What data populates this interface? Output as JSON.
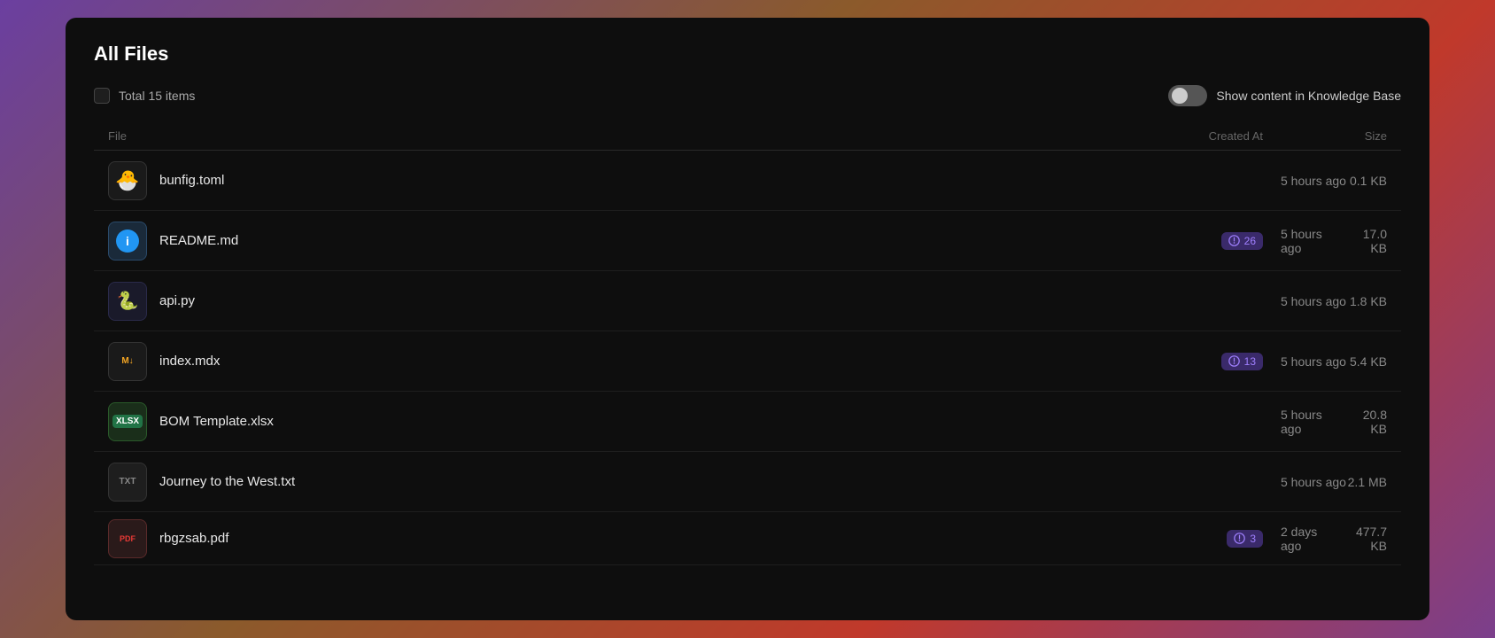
{
  "page": {
    "title": "All Files",
    "total_items_label": "Total 15 items",
    "toggle_label": "Show content in Knowledge Base"
  },
  "table": {
    "headers": {
      "file": "File",
      "created_at": "Created At",
      "size": "Size"
    },
    "rows": [
      {
        "id": "row-1",
        "name": "bunfig.toml",
        "icon_type": "bun",
        "icon_label": "🐣",
        "created_at": "5 hours ago",
        "size": "0.1 KB",
        "chunk_count": null
      },
      {
        "id": "row-2",
        "name": "README.md",
        "icon_type": "readme",
        "icon_label": "ℹ",
        "created_at": "5 hours ago",
        "size": "17.0 KB",
        "chunk_count": 26
      },
      {
        "id": "row-3",
        "name": "api.py",
        "icon_type": "py",
        "icon_label": "🐍",
        "created_at": "5 hours ago",
        "size": "1.8 KB",
        "chunk_count": null
      },
      {
        "id": "row-4",
        "name": "index.mdx",
        "icon_type": "mdx",
        "icon_label": "M↓",
        "created_at": "5 hours ago",
        "size": "5.4 KB",
        "chunk_count": 13
      },
      {
        "id": "row-5",
        "name": "BOM Template.xlsx",
        "icon_type": "xlsx",
        "icon_label": "XLSX",
        "created_at": "5 hours ago",
        "size": "20.8 KB",
        "chunk_count": null
      },
      {
        "id": "row-6",
        "name": "Journey to the West.txt",
        "icon_type": "txt",
        "icon_label": "TXT",
        "created_at": "5 hours ago",
        "size": "2.1 MB",
        "chunk_count": null
      },
      {
        "id": "row-7",
        "name": "rbgzsab.pdf",
        "icon_type": "pdf",
        "icon_label": "PDF",
        "created_at": "2 days ago",
        "size": "477.7 KB",
        "chunk_count": 3
      }
    ]
  }
}
